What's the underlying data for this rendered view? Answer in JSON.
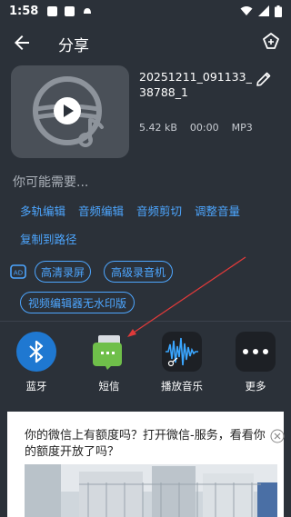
{
  "status_bar": {
    "time": "1:58",
    "icons": [
      "sim-card-icon",
      "image-icon",
      "android-debug-icon",
      "wifi-icon",
      "signal-icon",
      "battery-icon"
    ]
  },
  "header": {
    "title": "分享",
    "back_icon": "arrow-left-icon",
    "share_icon": "share-icon"
  },
  "recording": {
    "file_name": "20251211_091133_38788_1",
    "size": "5.42 kB",
    "duration": "00:00",
    "format": "MP3",
    "edit_icon": "pencil-icon"
  },
  "suggestions": {
    "label": "你可能需要...",
    "links": [
      "多轨编辑",
      "音频编辑",
      "音频剪切",
      "调整音量",
      "复制到路径"
    ],
    "ad_icon": "ad-icon",
    "pills": [
      "高清录屏",
      "高级录音机",
      "视频编辑器无水印版"
    ]
  },
  "share_targets": [
    {
      "label": "蓝牙",
      "icon": "bluetooth-icon",
      "color": "#1f78d1"
    },
    {
      "label": "短信",
      "icon": "sms-icon",
      "color": "#6fbf4a"
    },
    {
      "label": "播放音乐",
      "icon": "music-player-icon",
      "color": "#1d2025"
    },
    {
      "label": "更多",
      "icon": "more-icon",
      "color": "#1d2025"
    }
  ],
  "ad": {
    "text": "你的微信上有额度吗？打开微信-服务，看看你的额度开放了吗？",
    "close_icon": "close-icon"
  },
  "colors": {
    "background": "#2b3139",
    "accent": "#4da6ff",
    "annotation_arrow": "#e03a3a"
  }
}
